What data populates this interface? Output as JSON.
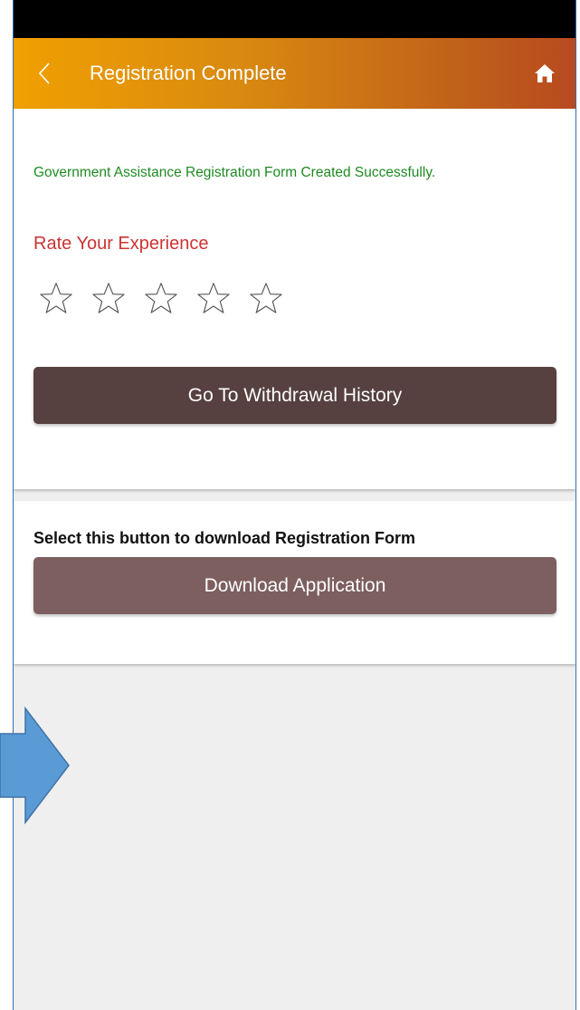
{
  "header": {
    "title": "Registration Complete",
    "back_icon": "chevron-left-icon",
    "home_icon": "home-icon",
    "gradient_colors": [
      "#f0a000",
      "#b84a20"
    ]
  },
  "content": {
    "success_message": "Government Assistance Registration Form Created Successfully.",
    "rate_label": "Rate Your Experience",
    "rating": {
      "value": 0,
      "max": 5
    },
    "withdrawal_button_label": "Go To Withdrawal History"
  },
  "download": {
    "instruction": "Select this button to download Registration Form",
    "button_label": "Download Application"
  },
  "colors": {
    "success_text": "#1e8a22",
    "rate_text": "#cc3333",
    "primary_button": "#564040",
    "secondary_button": "#7d5f5f",
    "annotation_arrow": "#5b9bd5"
  }
}
